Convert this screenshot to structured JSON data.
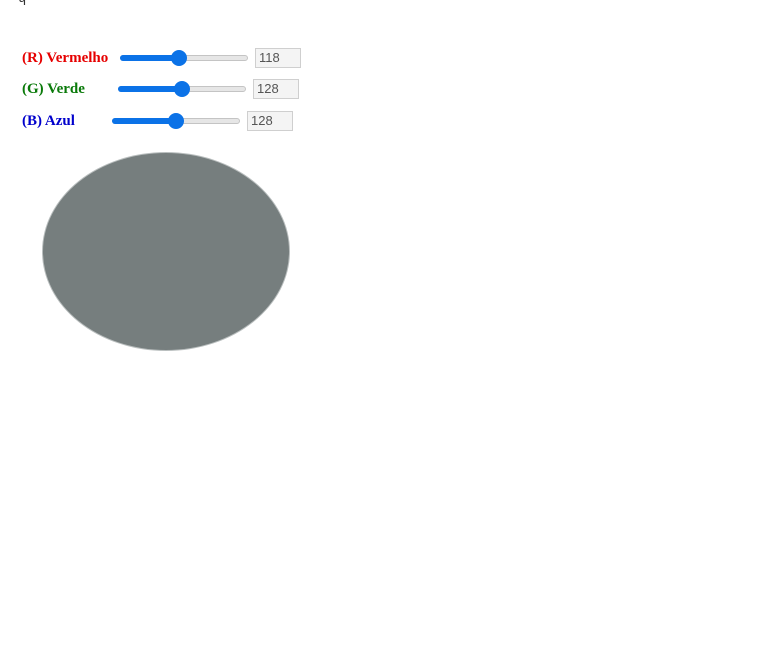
{
  "corner_glyph": "ɥ",
  "controls": {
    "red": {
      "label": "(R) Vermelho",
      "value": "118",
      "slider_fraction": 0.46,
      "color": "#e60000"
    },
    "green": {
      "label": "(G) Verde",
      "value": "128",
      "slider_fraction": 0.5,
      "color": "#0a7a0a"
    },
    "blue": {
      "label": "(B) Azul",
      "value": "128",
      "slider_fraction": 0.5,
      "color": "#0000cc"
    }
  },
  "preview": {
    "fill_color": "#767e7e"
  },
  "accent_color": "#0b72e7"
}
